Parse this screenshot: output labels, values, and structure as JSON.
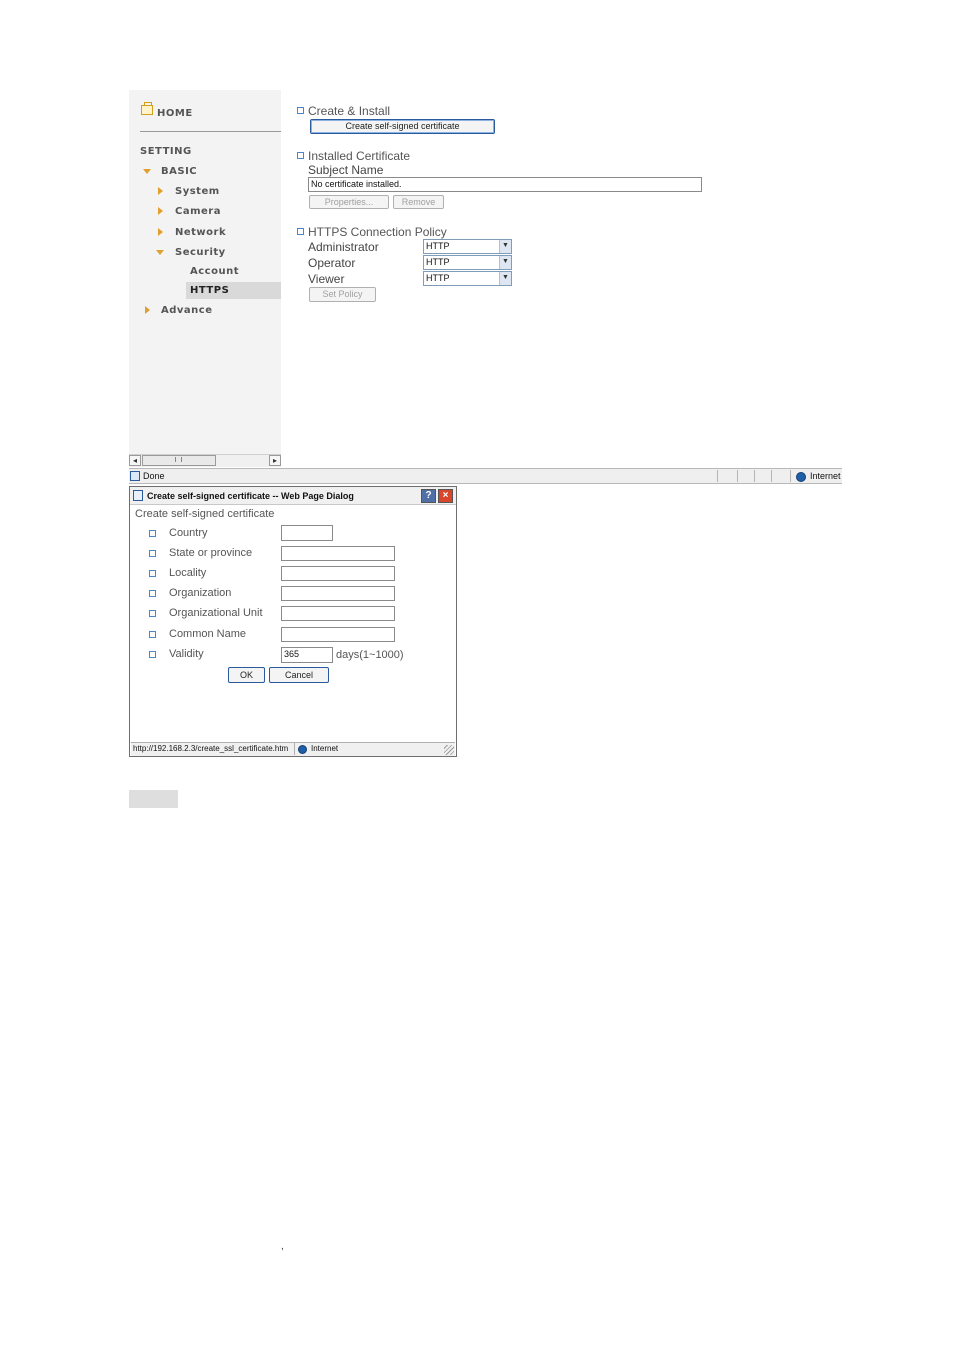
{
  "sidebar": {
    "home": "HOME",
    "setting": "SETTING",
    "basic": "BASIC",
    "items": [
      {
        "label": "System"
      },
      {
        "label": "Camera"
      },
      {
        "label": "Network"
      },
      {
        "label": "Security"
      }
    ],
    "security_sub": [
      {
        "label": "Account"
      },
      {
        "label": "HTTPS"
      }
    ],
    "advance": "Advance",
    "selected": "HTTPS"
  },
  "main": {
    "create_install": {
      "heading": "Create & Install",
      "button": "Create self-signed certificate"
    },
    "installed": {
      "heading": "Installed Certificate",
      "subject_label": "Subject Name",
      "subject_value": "No certificate installed.",
      "properties_button": "Properties...",
      "remove_button": "Remove"
    },
    "policy": {
      "heading": "HTTPS Connection Policy",
      "rows": [
        {
          "label": "Administrator",
          "value": "HTTP"
        },
        {
          "label": "Operator",
          "value": "HTTP"
        },
        {
          "label": "Viewer",
          "value": "HTTP"
        }
      ],
      "set_button": "Set Policy"
    }
  },
  "statusbar": {
    "text": "Done",
    "zone": "Internet"
  },
  "dialog": {
    "title": "Create self-signed certificate -- Web Page Dialog",
    "help": "?",
    "close": "×",
    "heading": "Create self-signed certificate",
    "fields": [
      {
        "label": "Country",
        "value": ""
      },
      {
        "label": "State or province",
        "value": ""
      },
      {
        "label": "Locality",
        "value": ""
      },
      {
        "label": "Organization",
        "value": ""
      },
      {
        "label": "Organizational Unit",
        "value": ""
      },
      {
        "label": "Common Name",
        "value": ""
      },
      {
        "label": "Validity",
        "value": "365"
      }
    ],
    "validity_suffix": "days(1~1000)",
    "ok": "OK",
    "cancel": "Cancel",
    "status_url": "http://192.168.2.3/create_ssl_certificate.htm",
    "status_zone": "Internet"
  },
  "footer_mark": ","
}
